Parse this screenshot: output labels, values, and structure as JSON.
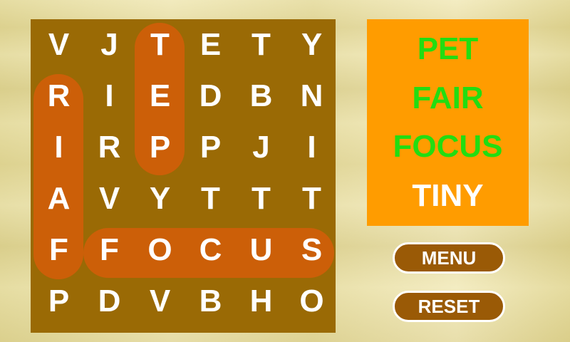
{
  "grid": {
    "rows": [
      [
        "V",
        "J",
        "T",
        "E",
        "T",
        "Y"
      ],
      [
        "R",
        "I",
        "E",
        "D",
        "B",
        "N"
      ],
      [
        "I",
        "R",
        "P",
        "P",
        "J",
        "I"
      ],
      [
        "A",
        "V",
        "Y",
        "T",
        "T",
        "T"
      ],
      [
        "F",
        "F",
        "O",
        "C",
        "U",
        "S"
      ],
      [
        "P",
        "D",
        "V",
        "B",
        "H",
        "O"
      ]
    ]
  },
  "words": [
    {
      "text": "PET",
      "found": true
    },
    {
      "text": "FAIR",
      "found": true
    },
    {
      "text": "FOCUS",
      "found": true
    },
    {
      "text": "TINY",
      "found": false
    }
  ],
  "buttons": {
    "menu_label": "MENU",
    "reset_label": "RESET"
  },
  "colors": {
    "board": "#9a6a05",
    "highlight": "#cc5f08",
    "panel": "#ff9c00",
    "found_word": "#22dd11",
    "pending_word": "#ffffff",
    "button": "#9a5a06"
  }
}
